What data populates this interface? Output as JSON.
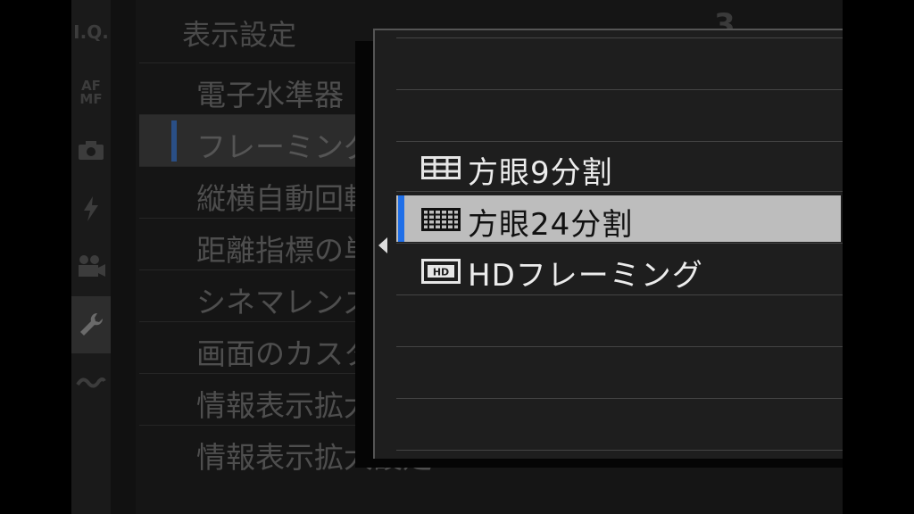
{
  "sidebar": {
    "icons": [
      {
        "name": "image-quality-icon",
        "text": "I.Q."
      },
      {
        "name": "af-mf-icon",
        "text": "AF MF"
      },
      {
        "name": "camera-icon",
        "text": ""
      },
      {
        "name": "flash-icon",
        "text": ""
      },
      {
        "name": "movie-icon",
        "text": ""
      },
      {
        "name": "wrench-icon",
        "text": ""
      },
      {
        "name": "wireless-icon",
        "text": ""
      }
    ]
  },
  "menu": {
    "title": "表示設定",
    "page_indicator": "3",
    "items": [
      {
        "label": "電子水準器"
      },
      {
        "label": "フレーミングガイド"
      },
      {
        "label": "縦横自動回転表示"
      },
      {
        "label": "距離指標の単位"
      },
      {
        "label": "シネマレンズ"
      },
      {
        "label": "画面のカスタム"
      },
      {
        "label": "情報表示拡大"
      },
      {
        "label": "情報表示拡大設定"
      }
    ]
  },
  "popup": {
    "options": [
      {
        "label": "方眼9分割",
        "icon": "grid-9-icon"
      },
      {
        "label": "方眼24分割",
        "icon": "grid-24-icon"
      },
      {
        "label": "HDフレーミング",
        "icon": "hd-framing-icon"
      }
    ]
  },
  "colors": {
    "accent": "#1f6fe8",
    "selected_bg": "#bdbdbd",
    "popup_bg": "#1e1e1e"
  }
}
